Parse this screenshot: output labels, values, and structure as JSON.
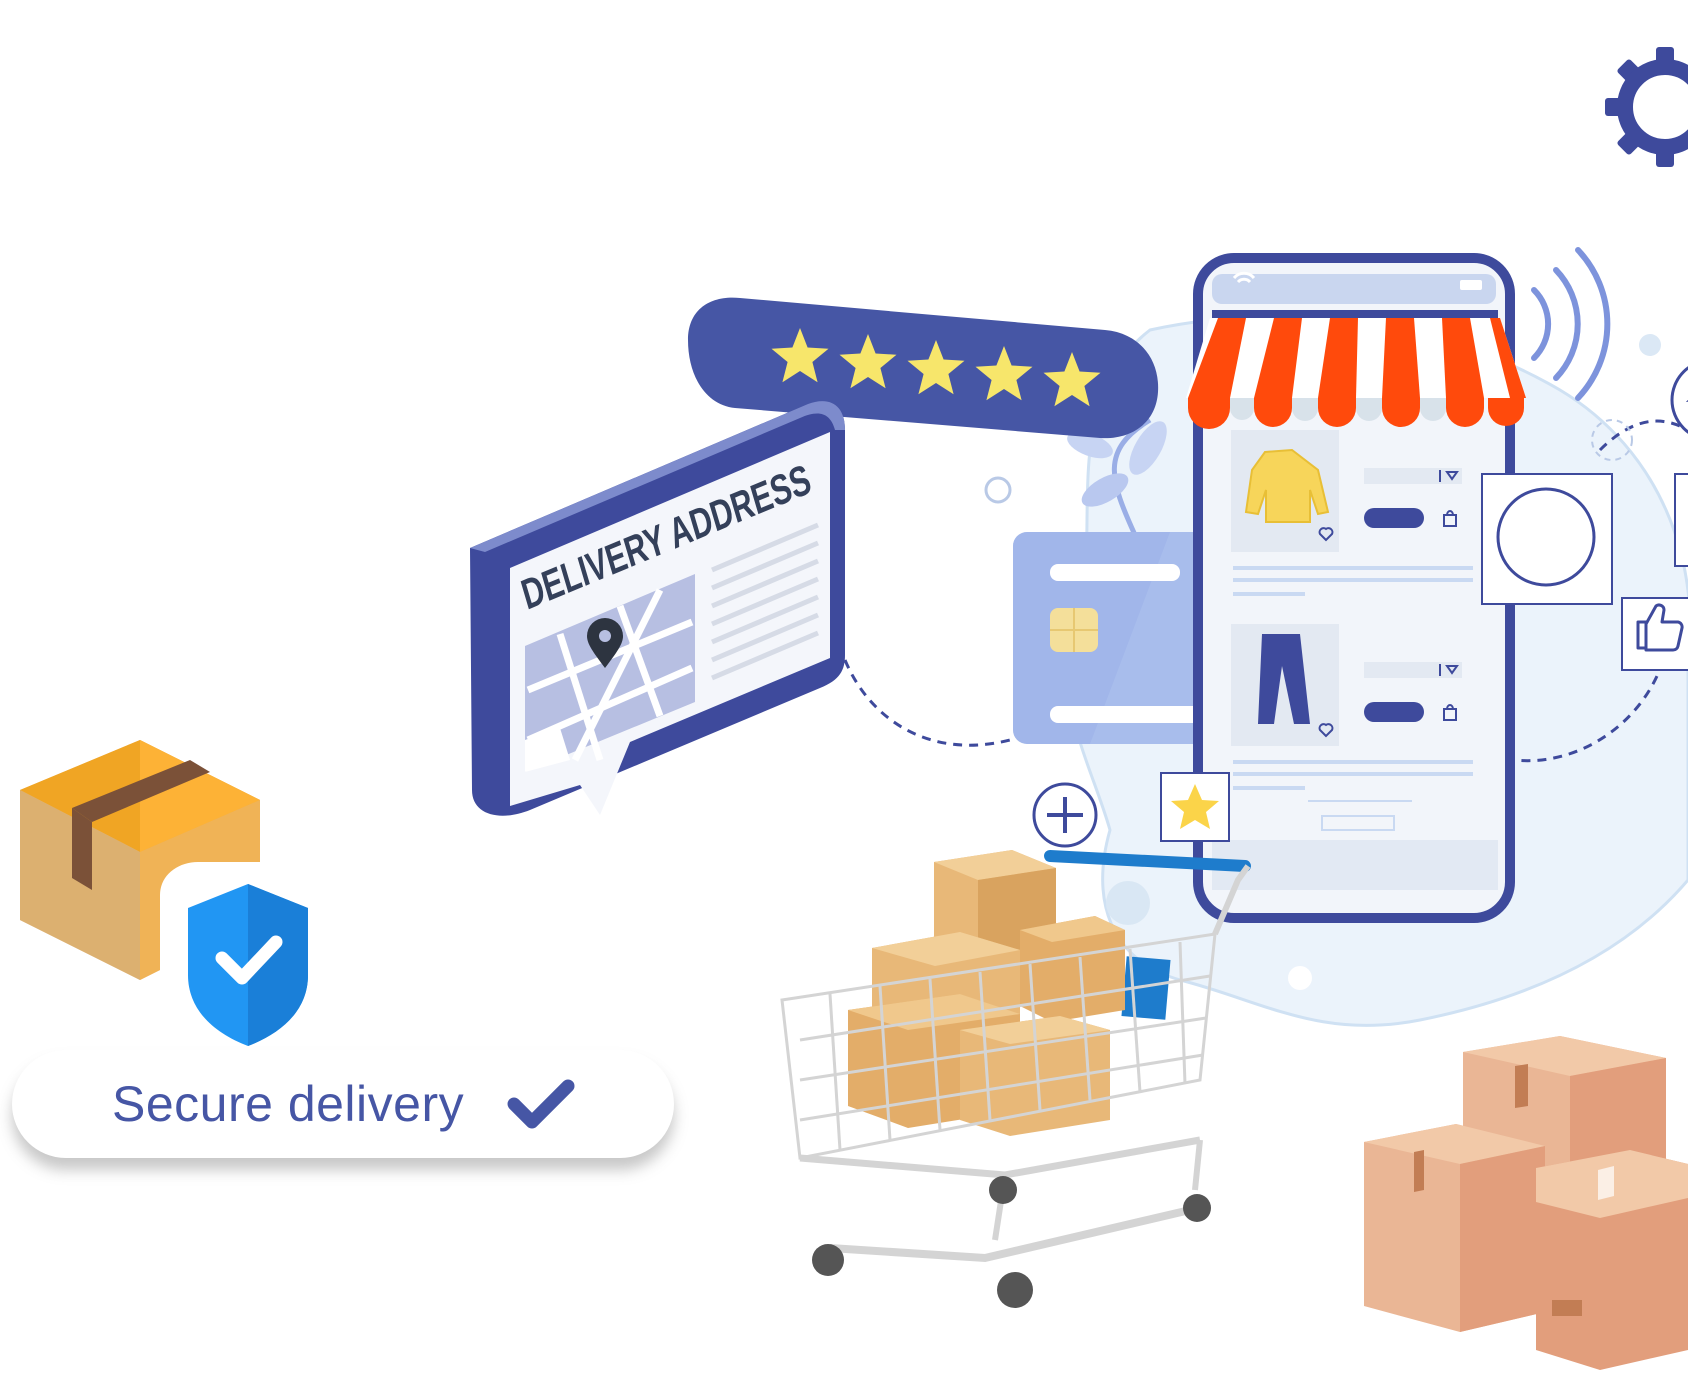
{
  "badge": {
    "label": "Secure delivery",
    "icon": "checkmark-icon"
  },
  "address_card": {
    "title": "DELIVERY ADDRESS",
    "icon": "map-pin-icon"
  },
  "rating": {
    "stars": 5,
    "max_stars": 5,
    "icon": "star-icon"
  },
  "phone": {
    "products": [
      {
        "item": "sweater",
        "icon": "sweater-icon"
      },
      {
        "item": "trousers",
        "icon": "trousers-icon"
      }
    ]
  },
  "icons": [
    "gear-icon",
    "shield-check-icon",
    "plus-circle-icon",
    "thumbs-up-icon",
    "heart-icon",
    "credit-card-icon",
    "shopping-cart-icon",
    "package-box-icon",
    "wifi-signal-icon"
  ],
  "colors": {
    "brand_blue": "#4656a5",
    "awning_red": "#ff4a0c",
    "star_yellow": "#f7e66b",
    "shield_blue": "#2196f3",
    "box_tan": "#e8b878",
    "box_peach": "#eab695"
  }
}
